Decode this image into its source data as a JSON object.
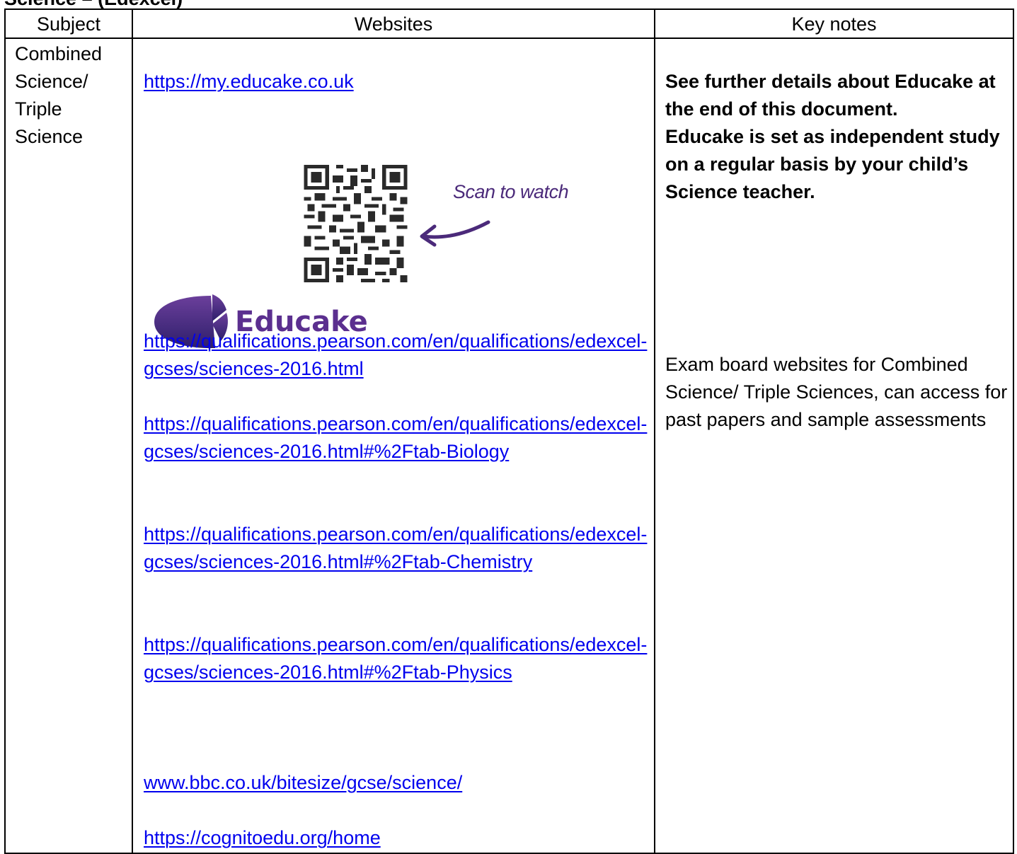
{
  "section_heading": "Science – (Edexcel)",
  "table": {
    "headers": {
      "subject": "Subject",
      "websites": "Websites",
      "key_notes": "Key notes"
    },
    "subject": "Combined Science/ Triple Science",
    "links": {
      "educake": "https://my.educake.co.uk",
      "pearson_main": "https://qualifications.pearson.com/en/qualifications/edexcel-gcses/sciences-2016.html",
      "pearson_biology": "https://qualifications.pearson.com/en/qualifications/edexcel-gcses/sciences-2016.html#%2Ftab-Biology",
      "pearson_chemistry": "https://qualifications.pearson.com/en/qualifications/edexcel-gcses/sciences-2016.html#%2Ftab-Chemistry",
      "pearson_physics": "https://qualifications.pearson.com/en/qualifications/edexcel-gcses/sciences-2016.html#%2Ftab-Physics",
      "bbc": "www.bbc.co.uk/bitesize/gcse/science/",
      "cognito": "https://cognitoedu.org/home"
    },
    "qr_caption": "Scan to watch",
    "logo_text": "Educake",
    "key_notes": {
      "educake_note_1": "See further details about Educake at the end of this document.",
      "educake_note_2": "Educake is set as independent study on a regular basis by your child’s Science teacher.",
      "exam_board_note": "Exam board websites for Combined Science/ Triple Sciences, can access for past papers and sample assessments"
    }
  },
  "colors": {
    "link": "#0000ee",
    "brand_purple": "#4b2a7a"
  }
}
